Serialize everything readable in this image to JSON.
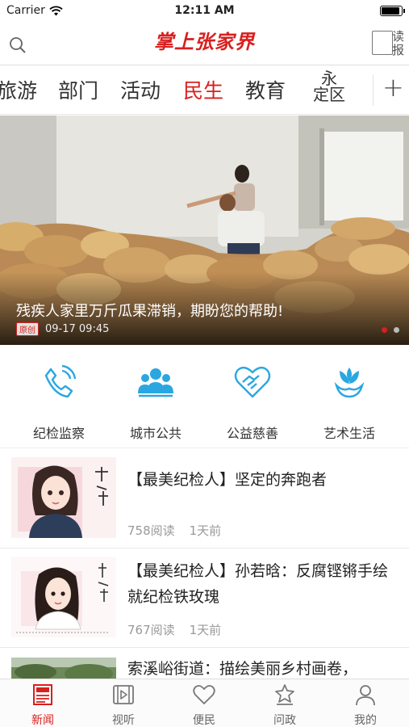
{
  "status_bar": {
    "carrier": "Carrier",
    "time": "12:11 AM"
  },
  "header": {
    "brand": "掌上张家界",
    "read_label_top": "读",
    "read_label_bottom": "报"
  },
  "tabs": {
    "items": [
      {
        "label": "旅游"
      },
      {
        "label": "部门"
      },
      {
        "label": "活动"
      },
      {
        "label": "民生",
        "active": true
      },
      {
        "label": "教育"
      },
      {
        "label_top": "永",
        "label_bottom": "定区"
      }
    ],
    "add_label": "+"
  },
  "banner": {
    "title": "残疾人家里万斤瓜果滞销，期盼您的帮助!",
    "badge": "原创",
    "date": "09-17 09:45",
    "page_count": 2,
    "active_page": 1
  },
  "quick_entries": [
    {
      "label": "纪检监察",
      "icon": "phone-icon"
    },
    {
      "label": "城市公共",
      "icon": "people-icon"
    },
    {
      "label": "公益慈善",
      "icon": "handshake-icon"
    },
    {
      "label": "艺术生活",
      "icon": "flower-icon"
    }
  ],
  "news": [
    {
      "title": "【最美纪检人】坚定的奔跑者",
      "reads": "758阅读",
      "time": "1天前",
      "signature": "李宁"
    },
    {
      "title": "【最美纪检人】孙若晗：反腐铿锵手绘就纪检铁玫瑰",
      "reads": "767阅读",
      "time": "1天前",
      "signature": "孙若晗"
    },
    {
      "title": "索溪峪街道：描绘美丽乡村画卷，"
    }
  ],
  "bottom_nav": [
    {
      "label": "新闻",
      "icon": "newspaper-icon",
      "active": true
    },
    {
      "label": "视听",
      "icon": "film-icon"
    },
    {
      "label": "便民",
      "icon": "heart-icon"
    },
    {
      "label": "问政",
      "icon": "star-badge-icon"
    },
    {
      "label": "我的",
      "icon": "user-icon"
    }
  ],
  "colors": {
    "accent": "#d8201f",
    "icon_blue": "#2aa7e0"
  }
}
